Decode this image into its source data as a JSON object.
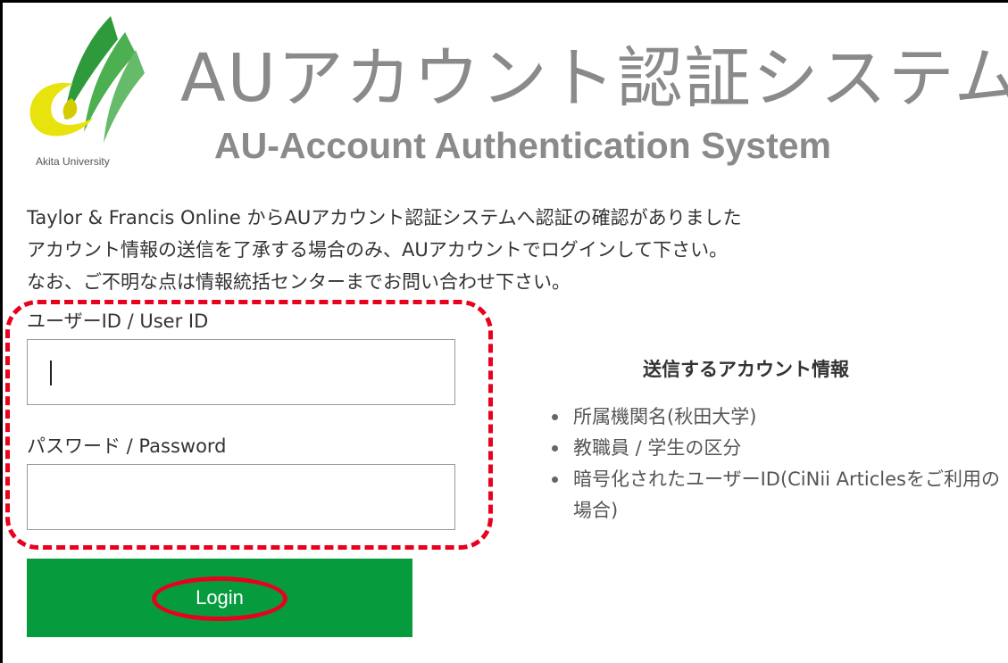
{
  "header": {
    "title_ja": "AUアカウント認証システム",
    "title_en": "AU-Account Authentication System",
    "logo_caption": "Akita University"
  },
  "intro": {
    "lines": [
      "Taylor & Francis Online からAUアカウント認証システムへ認証の確認がありました",
      "アカウント情報の送信を了承する場合のみ、AUアカウントでログインして下さい。",
      "なお、ご不明な点は情報統括センターまでお問い合わせ下さい。"
    ]
  },
  "form": {
    "user_id_label": "ユーザーID / User ID",
    "user_id_value": "",
    "password_label": "パスワード / Password",
    "password_value": "",
    "login_label": "Login"
  },
  "info": {
    "heading": "送信するアカウント情報",
    "items": [
      "所属機関名(秋田大学)",
      "教職員 / 学生の区分",
      "暗号化されたユーザーID(CiNii Articlesをご利用の場合)"
    ]
  },
  "colors": {
    "login_button": "#069c3e",
    "annotation_red": "#e8001c",
    "title_gray": "#8a8a8a",
    "logo_green": "#2f9a3c",
    "logo_yellow": "#e8e30c"
  }
}
